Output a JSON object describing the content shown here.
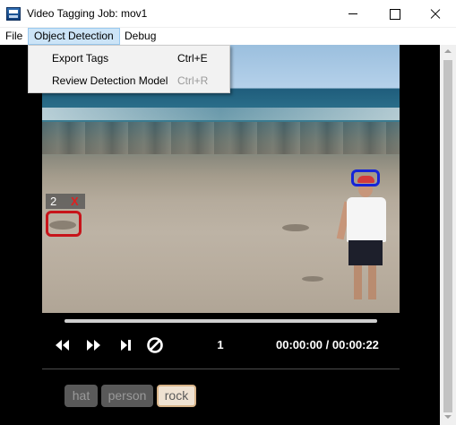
{
  "window": {
    "title": "Video Tagging Job: mov1"
  },
  "menubar": {
    "items": [
      {
        "label": "File"
      },
      {
        "label": "Object Detection"
      },
      {
        "label": "Debug"
      }
    ]
  },
  "dropdown": {
    "items": [
      {
        "label": "Export Tags",
        "shortcut": "Ctrl+E",
        "enabled": true
      },
      {
        "label": "Review Detection Model",
        "shortcut": "Ctrl+R",
        "enabled": false
      }
    ]
  },
  "video": {
    "selected_region": {
      "number": "2",
      "delete_glyph": "X"
    },
    "region_colors": {
      "hat": "#1525d8",
      "rock": "#c7141a"
    }
  },
  "player": {
    "frame_number": "1",
    "time_display": "00:00:00 / 00:00:22",
    "progress_fraction": 1.0,
    "controls": [
      {
        "icon": "rewind-icon"
      },
      {
        "icon": "fast-forward-icon"
      },
      {
        "icon": "step-forward-icon"
      },
      {
        "icon": "stop-icon"
      }
    ]
  },
  "tags": [
    {
      "label": "hat",
      "selected": false
    },
    {
      "label": "person",
      "selected": false
    },
    {
      "label": "rock",
      "selected": true
    }
  ]
}
